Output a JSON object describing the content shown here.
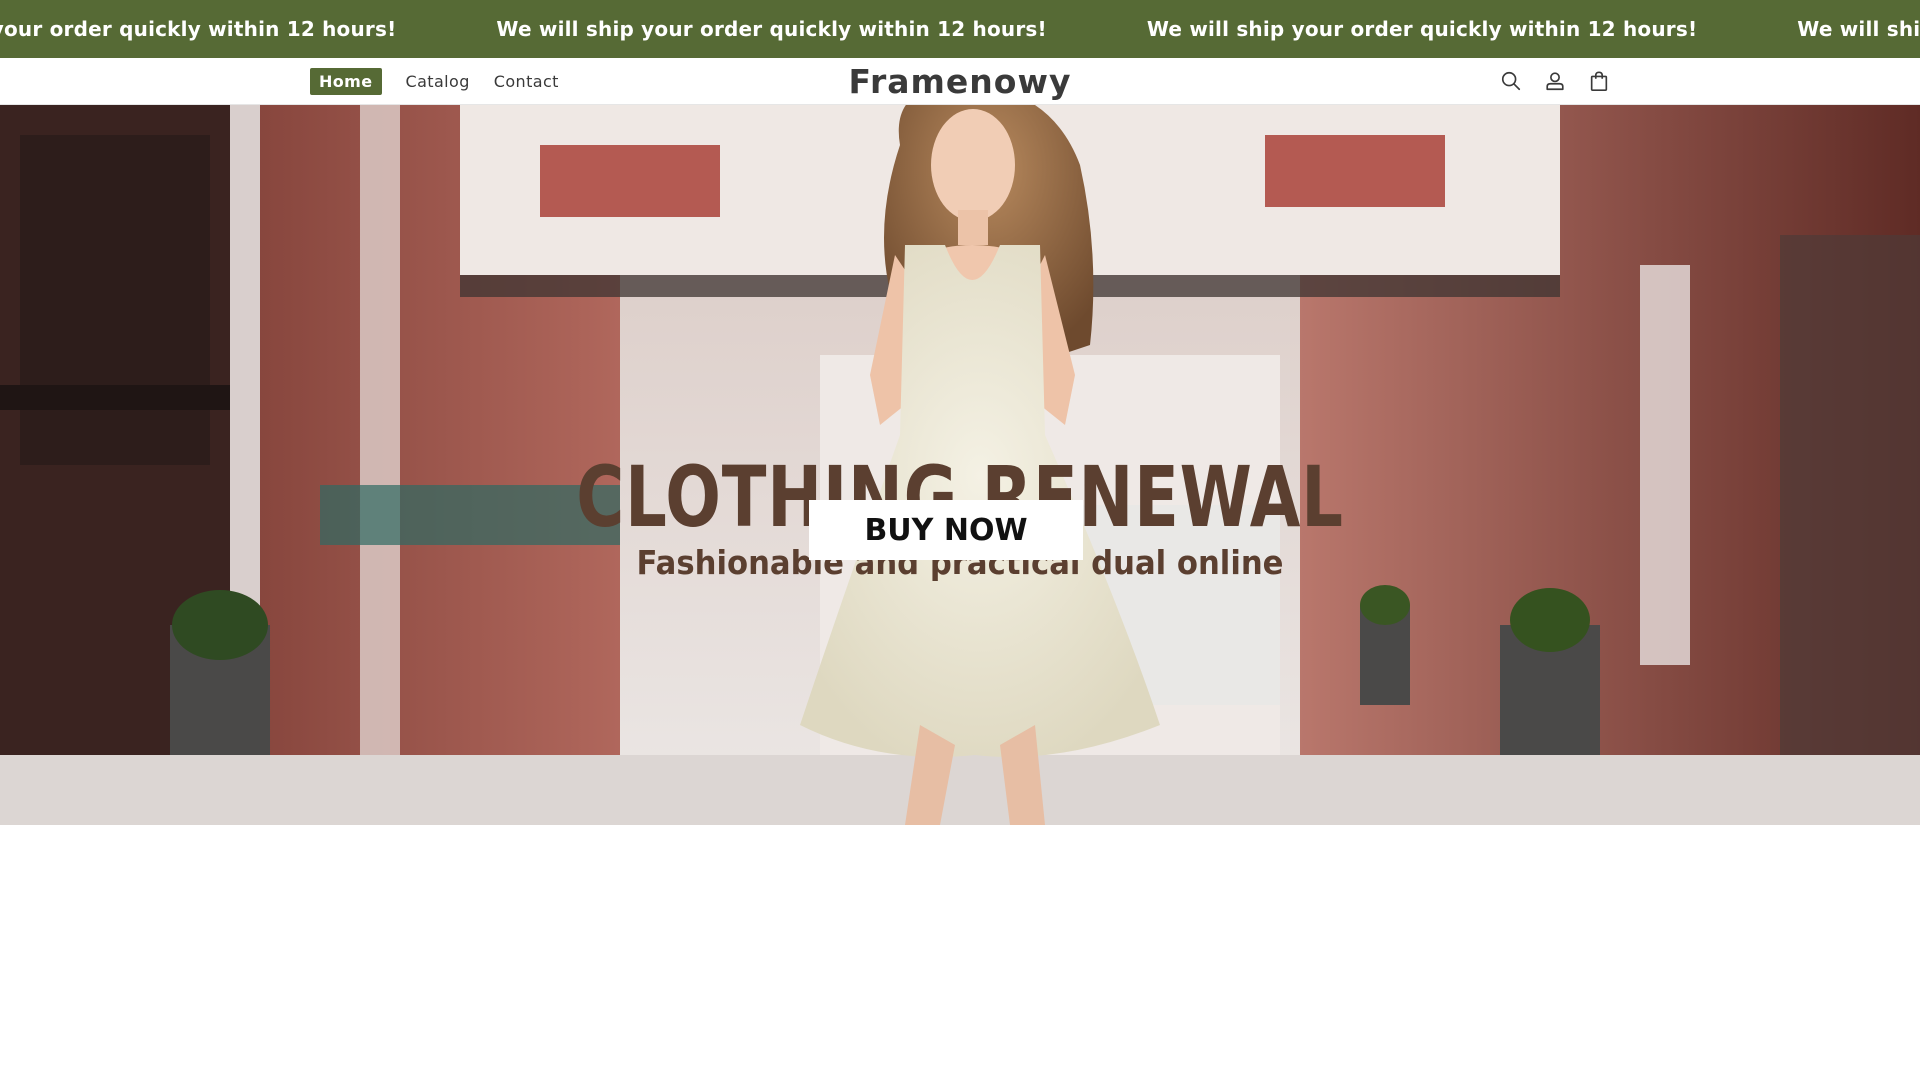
{
  "announcement": {
    "text": "We will ship your order quickly within 12 hours!",
    "background": "#566a35"
  },
  "nav": {
    "items": [
      {
        "label": "Home",
        "active": true
      },
      {
        "label": "Catalog",
        "active": false
      },
      {
        "label": "Contact",
        "active": false
      }
    ]
  },
  "brand": {
    "name": "Framenowy"
  },
  "icons": [
    "search-icon",
    "account-icon",
    "cart-icon"
  ],
  "hero": {
    "title": "CLOTHING RENEWAL",
    "subtitle": "Fashionable and practical dual online",
    "button_label": "BUY NOW",
    "text_color": "#5b3f30"
  }
}
